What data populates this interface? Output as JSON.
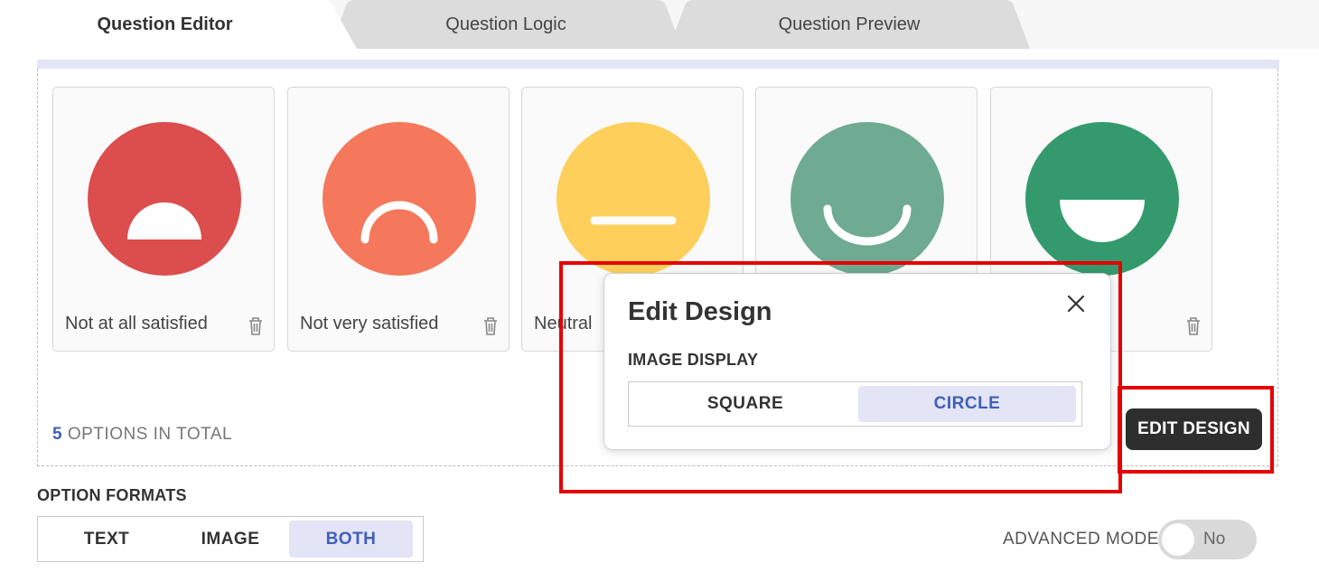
{
  "tabs": [
    {
      "label": "Question Editor",
      "active": true
    },
    {
      "label": "Question Logic",
      "active": false
    },
    {
      "label": "Question Preview",
      "active": false
    }
  ],
  "options": [
    {
      "label": "Not at all satisfied",
      "face": "very-sad",
      "color": "#dc4d4d"
    },
    {
      "label": "Not very satisfied",
      "face": "sad",
      "color": "#f5775c"
    },
    {
      "label": "Neutral",
      "face": "neutral",
      "color": "#fecf5b"
    },
    {
      "label": "",
      "face": "happy",
      "color": "#6eab92"
    },
    {
      "label": "",
      "face": "very-happy",
      "color": "#349a6d"
    }
  ],
  "total": {
    "count": "5",
    "suffix": "OPTIONS IN TOTAL"
  },
  "option_formats": {
    "label": "OPTION FORMATS",
    "options": [
      "TEXT",
      "IMAGE",
      "BOTH"
    ],
    "selected": "BOTH"
  },
  "advanced_mode": {
    "label": "ADVANCED MODE",
    "value": "No"
  },
  "edit_design_button": "EDIT DESIGN",
  "popover": {
    "title": "Edit Design",
    "section": "IMAGE DISPLAY",
    "options": [
      "SQUARE",
      "CIRCLE"
    ],
    "selected": "CIRCLE"
  },
  "colors": {
    "accent": "#3f5fb8",
    "selected_bg": "#e3e4f6",
    "highlight": "#e60000",
    "button_dark": "#2e2e2e"
  }
}
